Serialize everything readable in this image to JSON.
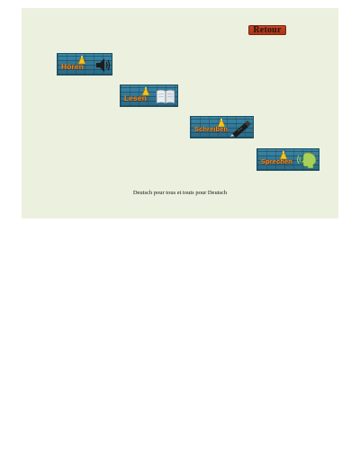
{
  "header": {
    "back_label": "Retour"
  },
  "tiles": [
    {
      "label": "Hören",
      "icon": "speaker-icon"
    },
    {
      "label": "Lesen",
      "icon": "book-icon"
    },
    {
      "label": "Schreiben",
      "icon": "pen-icon"
    },
    {
      "label": "Sprechen",
      "icon": "speaking-head-icon"
    }
  ],
  "footer": {
    "caption": "Deutsch pour tous et touts pour Deutsch"
  },
  "colors": {
    "page_background": "#ecf0de",
    "tile_blue": "#2f7592",
    "label_orange": "#f08b24",
    "lamp_yellow": "#f6c31b",
    "back_button_red": "#b8391d"
  }
}
